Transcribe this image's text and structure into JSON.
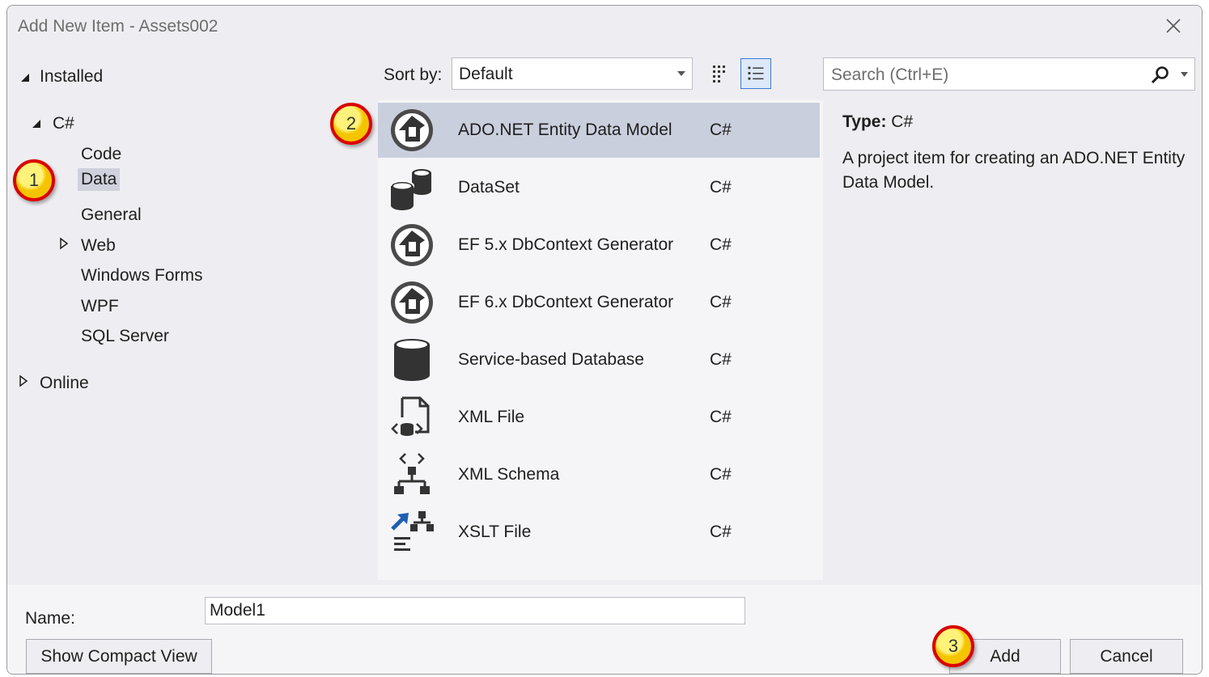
{
  "window": {
    "title": "Add New Item - Assets002"
  },
  "tree": {
    "installed": "Installed",
    "language": "C#",
    "categories": [
      "Code",
      "Data",
      "General",
      "Web",
      "Windows Forms",
      "WPF",
      "SQL Server"
    ],
    "selected": "Data",
    "online": "Online"
  },
  "sort": {
    "label": "Sort by:",
    "value": "Default"
  },
  "search": {
    "placeholder": "Search (Ctrl+E)"
  },
  "items": [
    {
      "name": "ADO.NET Entity Data Model",
      "lang": "C#",
      "icon": "entity-model-icon"
    },
    {
      "name": "DataSet",
      "lang": "C#",
      "icon": "dataset-icon"
    },
    {
      "name": "EF 5.x DbContext Generator",
      "lang": "C#",
      "icon": "entity-model-icon"
    },
    {
      "name": "EF 6.x DbContext Generator",
      "lang": "C#",
      "icon": "entity-model-icon"
    },
    {
      "name": "Service-based Database",
      "lang": "C#",
      "icon": "database-icon"
    },
    {
      "name": "XML File",
      "lang": "C#",
      "icon": "xml-file-icon"
    },
    {
      "name": "XML Schema",
      "lang": "C#",
      "icon": "xml-schema-icon"
    },
    {
      "name": "XSLT File",
      "lang": "C#",
      "icon": "xslt-file-icon"
    }
  ],
  "selected_item": "ADO.NET Entity Data Model",
  "details": {
    "type_label": "Type:",
    "type_value": "C#",
    "description": "A project item for creating an ADO.NET Entity Data Model."
  },
  "footer": {
    "name_label": "Name:",
    "name_value": "Model1",
    "compact_view": "Show Compact View",
    "add": "Add",
    "cancel": "Cancel"
  },
  "badges": [
    "1",
    "2",
    "3"
  ],
  "colors": {
    "selection": "#cacfdd",
    "badge_fill": "#f5c400",
    "badge_ring": "#d90000",
    "accent": "#3c78d8"
  }
}
